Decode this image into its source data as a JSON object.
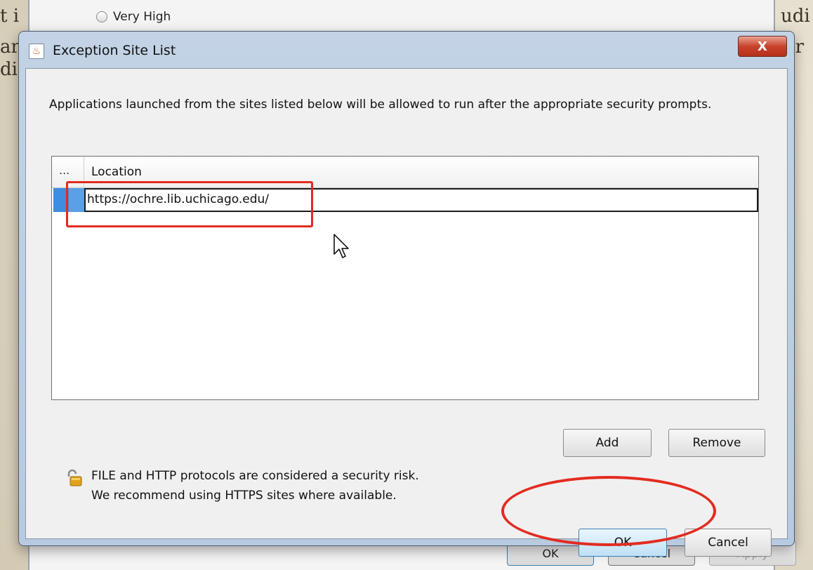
{
  "background": {
    "left_fragments": [
      "t i",
      "ar",
      "di"
    ],
    "right_fragments": [
      "udi",
      "pr"
    ]
  },
  "parent_dialog": {
    "radio_label": "Very High",
    "buttons": [
      "OK",
      "Cancel",
      "Apply"
    ]
  },
  "dialog": {
    "title": "Exception Site List",
    "close_label": "X",
    "description": "Applications launched from the sites listed below will be allowed to run after the appropriate security prompts.",
    "table": {
      "columns": [
        "...",
        "Location"
      ],
      "rows": [
        "https://ochre.lib.uchicago.edu/"
      ]
    },
    "add_label": "Add",
    "remove_label": "Remove",
    "warning_line1": "FILE and HTTP protocols are considered a security risk.",
    "warning_line2": "We recommend using HTTPS sites where available.",
    "ok_label": "OK",
    "cancel_label": "Cancel"
  },
  "colors": {
    "annotation": "#e32b20",
    "selection": "#3d8ee0"
  }
}
